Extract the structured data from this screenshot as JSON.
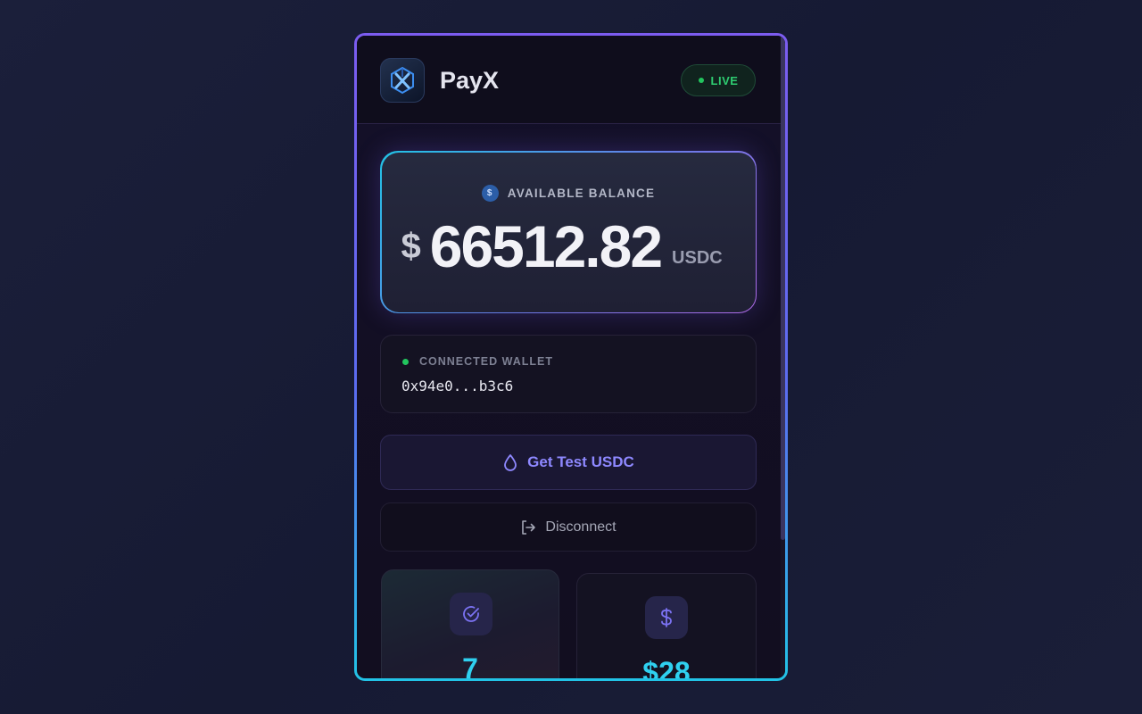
{
  "header": {
    "brand": "PayX",
    "status_badge": "LIVE"
  },
  "balance": {
    "label": "AVAILABLE BALANCE",
    "coin_symbol": "$",
    "currency_symbol": "$",
    "amount": "66512.82",
    "unit": "USDC"
  },
  "wallet": {
    "label": "CONNECTED WALLET",
    "address": "0x94e0...b3c6"
  },
  "actions": {
    "faucet_label": "Get Test USDC",
    "disconnect_label": "Disconnect"
  },
  "stats": [
    {
      "icon": "check-circle-icon",
      "value": "7"
    },
    {
      "icon": "dollar-icon",
      "value": "$28"
    }
  ],
  "colors": {
    "accent_purple": "#7c5cf0",
    "accent_cyan": "#22c3e6",
    "live_green": "#22c55e",
    "faucet_text": "#8e88ff"
  }
}
